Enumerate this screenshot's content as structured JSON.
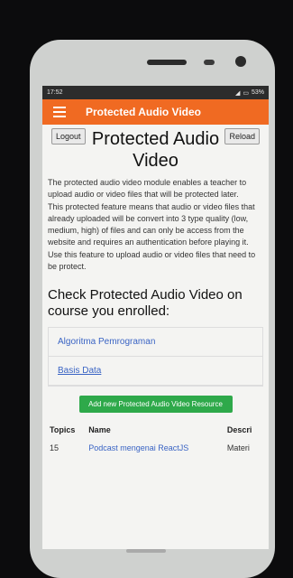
{
  "status": {
    "time": "17:52",
    "battery": "53%"
  },
  "appbar": {
    "title": "Protected Audio Video"
  },
  "header": {
    "logout": "Logout",
    "reload": "Reload",
    "title": "Protected Audio Video"
  },
  "description": "The protected audio video module enables a teacher to upload audio or video files that will be protected later.\nThis protected feature means that audio or video files that already uploaded will be convert into 3 type quality (low, medium, high) of files and can only be access from the website and requires an authentication before playing it.\nUse this feature to upload audio or video files that need to be protect.",
  "section": {
    "heading": "Check Protected Audio Video on course you enrolled:"
  },
  "courses": [
    "Algoritma Pemrograman",
    "Basis Data"
  ],
  "add_button": "Add new Protected Audio Video Resource",
  "table": {
    "headers": [
      "Topics",
      "Name",
      "Descri"
    ],
    "rows": [
      {
        "topic": "15",
        "name": "Podcast mengenai ReactJS",
        "desc": "Materi"
      }
    ]
  }
}
